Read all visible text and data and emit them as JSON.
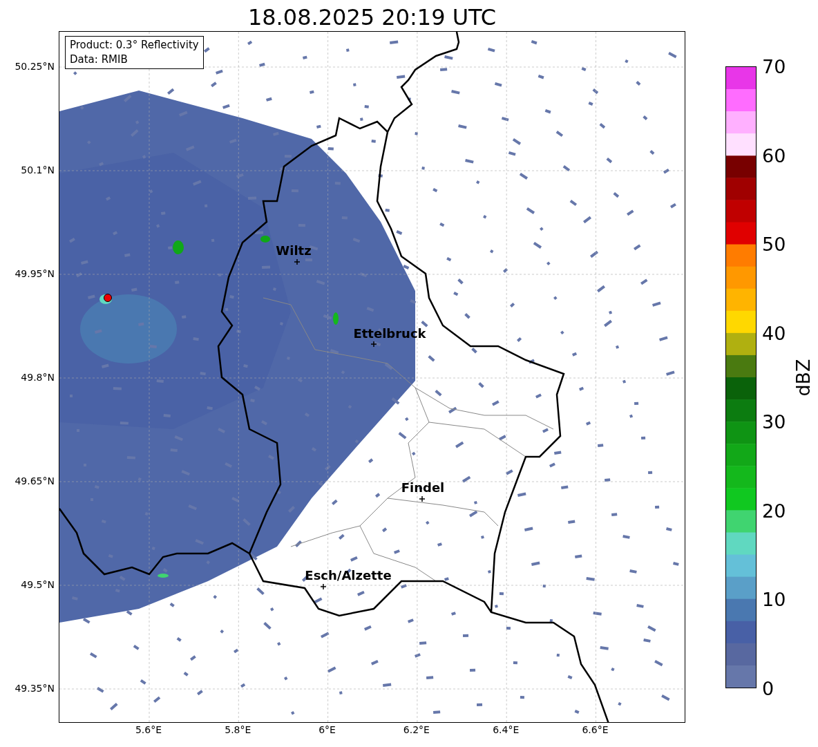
{
  "title": "18.08.2025 20:19 UTC",
  "info_box": [
    "Product: 0.3° Reflectivity",
    "Data: RMIB"
  ],
  "cities": [
    {
      "name": "Wiltz"
    },
    {
      "name": "Ettelbruck"
    },
    {
      "name": "Findel"
    },
    {
      "name": "Esch/Alzette"
    }
  ],
  "lat_ticks": [
    "50.25°N",
    "50.1°N",
    "49.95°N",
    "49.8°N",
    "49.65°N",
    "49.5°N",
    "49.35°N"
  ],
  "lon_ticks": [
    "5.6°E",
    "5.8°E",
    "6°E",
    "6.2°E",
    "6.4°E",
    "6.6°E"
  ],
  "colorbar": {
    "label": "dBZ",
    "ticks": [
      "70",
      "60",
      "50",
      "40",
      "30",
      "20",
      "10",
      "0"
    ],
    "segments": [
      {
        "color": "#e836e8"
      },
      {
        "color": "#ff6cff"
      },
      {
        "color": "#ffb0ff"
      },
      {
        "color": "#ffe0ff"
      },
      {
        "color": "#780000"
      },
      {
        "color": "#a00000"
      },
      {
        "color": "#c00000"
      },
      {
        "color": "#e00000"
      },
      {
        "color": "#ff7c00"
      },
      {
        "color": "#ff9800"
      },
      {
        "color": "#ffb400"
      },
      {
        "color": "#ffd800"
      },
      {
        "color": "#b0b010"
      },
      {
        "color": "#4a7a10"
      },
      {
        "color": "#0a620a"
      },
      {
        "color": "#0c7c10"
      },
      {
        "color": "#0f9414"
      },
      {
        "color": "#12a818"
      },
      {
        "color": "#14b81c"
      },
      {
        "color": "#10c820"
      },
      {
        "color": "#40d470"
      },
      {
        "color": "#60d8c0"
      },
      {
        "color": "#64c0d8"
      },
      {
        "color": "#5a9fc8"
      },
      {
        "color": "#4a78b0"
      },
      {
        "color": "#4860a6"
      },
      {
        "color": "#5868a0"
      },
      {
        "color": "#6677aa"
      }
    ]
  }
}
